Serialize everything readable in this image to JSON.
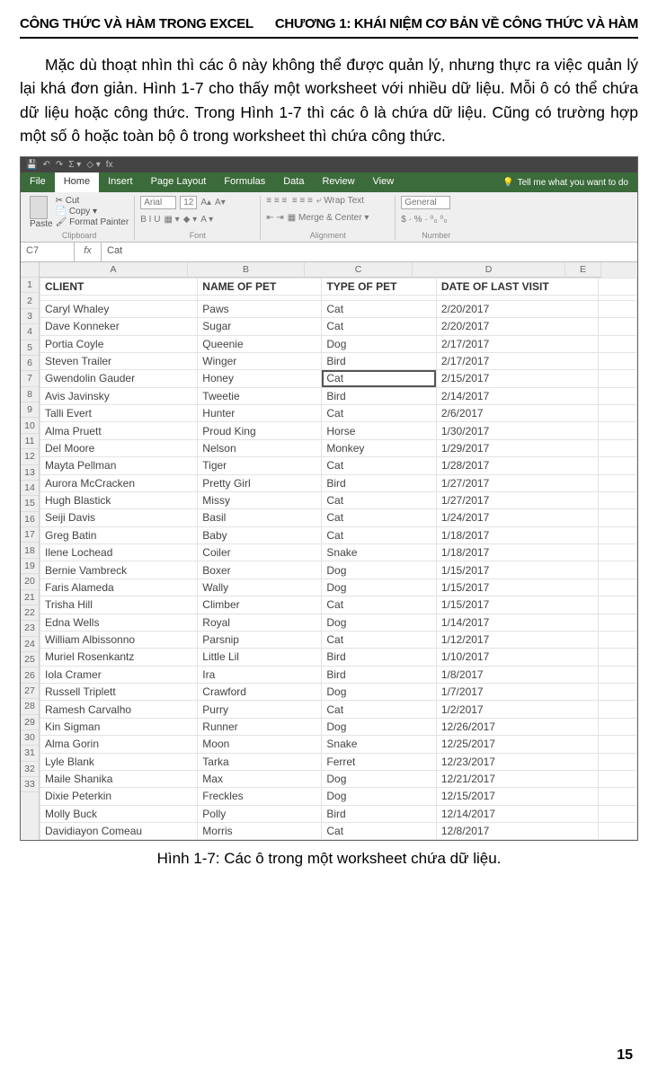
{
  "header": {
    "left": "CÔNG THỨC VÀ HÀM TRONG EXCEL",
    "right": "CHƯƠNG 1: KHÁI NIỆM CƠ BẢN VỀ CÔNG THỨC VÀ HÀM"
  },
  "paragraph": "Mặc dù thoạt nhìn thì các ô này không thể được quản lý, nhưng thực ra việc quản lý lại khá đơn giản. Hình 1-7 cho thấy một worksheet với nhiều dữ liệu. Mỗi ô có thể chứa dữ liệu hoặc công thức. Trong Hình 1-7 thì các ô là chứa dữ liệu. Cũng có trường hợp một số ô hoặc toàn bộ ô trong worksheet thì chứa công thức.",
  "excel": {
    "tabs": [
      "File",
      "Home",
      "Insert",
      "Page Layout",
      "Formulas",
      "Data",
      "Review",
      "View"
    ],
    "active_tab_index": 1,
    "tell_me": "Tell me what you want to do",
    "ribbon": {
      "clipboard": {
        "label": "Clipboard",
        "paste": "Paste",
        "cut": "Cut",
        "copy": "Copy",
        "painter": "Format Painter"
      },
      "font": {
        "label": "Font",
        "name": "Arial",
        "size": "12",
        "buttons": "B  I  U"
      },
      "alignment": {
        "label": "Alignment",
        "wrap": "Wrap Text",
        "merge": "Merge & Center"
      },
      "number": {
        "label": "Number",
        "format": "General",
        "symbols": "$ · % · ⁰₀ ⁰₀"
      }
    },
    "name_box": "C7",
    "fx_content": "Cat",
    "columns": [
      "A",
      "B",
      "C",
      "D",
      "E"
    ],
    "headers": [
      "CLIENT",
      "NAME OF PET",
      "TYPE OF PET",
      "DATE OF LAST VISIT",
      ""
    ],
    "selected": {
      "row": 7,
      "col": 2
    },
    "rows": [
      [
        "",
        "",
        "",
        "",
        ""
      ],
      [
        "Caryl Whaley",
        "Paws",
        "Cat",
        "2/20/2017",
        ""
      ],
      [
        "Dave Konneker",
        "Sugar",
        "Cat",
        "2/20/2017",
        ""
      ],
      [
        "Portia Coyle",
        "Queenie",
        "Dog",
        "2/17/2017",
        ""
      ],
      [
        "Steven Trailer",
        "Winger",
        "Bird",
        "2/17/2017",
        ""
      ],
      [
        "Gwendolin Gauder",
        "Honey",
        "Cat",
        "2/15/2017",
        ""
      ],
      [
        "Avis Javinsky",
        "Tweetie",
        "Bird",
        "2/14/2017",
        ""
      ],
      [
        "Talli Evert",
        "Hunter",
        "Cat",
        "2/6/2017",
        ""
      ],
      [
        "Alma Pruett",
        "Proud King",
        "Horse",
        "1/30/2017",
        ""
      ],
      [
        "Del Moore",
        "Nelson",
        "Monkey",
        "1/29/2017",
        ""
      ],
      [
        "Mayta Pellman",
        "Tiger",
        "Cat",
        "1/28/2017",
        ""
      ],
      [
        "Aurora McCracken",
        "Pretty Girl",
        "Bird",
        "1/27/2017",
        ""
      ],
      [
        "Hugh Blastick",
        "Missy",
        "Cat",
        "1/27/2017",
        ""
      ],
      [
        "Seiji Davis",
        "Basil",
        "Cat",
        "1/24/2017",
        ""
      ],
      [
        "Greg Batin",
        "Baby",
        "Cat",
        "1/18/2017",
        ""
      ],
      [
        "Ilene Lochead",
        "Coiler",
        "Snake",
        "1/18/2017",
        ""
      ],
      [
        "Bernie Vambreck",
        "Boxer",
        "Dog",
        "1/15/2017",
        ""
      ],
      [
        "Faris Alameda",
        "Wally",
        "Dog",
        "1/15/2017",
        ""
      ],
      [
        "Trisha Hill",
        "Climber",
        "Cat",
        "1/15/2017",
        ""
      ],
      [
        "Edna Wells",
        "Royal",
        "Dog",
        "1/14/2017",
        ""
      ],
      [
        "William Albissonno",
        "Parsnip",
        "Cat",
        "1/12/2017",
        ""
      ],
      [
        "Muriel Rosenkantz",
        "Little Lil",
        "Bird",
        "1/10/2017",
        ""
      ],
      [
        "Iola Cramer",
        "Ira",
        "Bird",
        "1/8/2017",
        ""
      ],
      [
        "Russell Triplett",
        "Crawford",
        "Dog",
        "1/7/2017",
        ""
      ],
      [
        "Ramesh Carvalho",
        "Purry",
        "Cat",
        "1/2/2017",
        ""
      ],
      [
        "Kin Sigman",
        "Runner",
        "Dog",
        "12/26/2017",
        ""
      ],
      [
        "Alma Gorin",
        "Moon",
        "Snake",
        "12/25/2017",
        ""
      ],
      [
        "Lyle Blank",
        "Tarka",
        "Ferret",
        "12/23/2017",
        ""
      ],
      [
        "Maile Shanika",
        "Max",
        "Dog",
        "12/21/2017",
        ""
      ],
      [
        "Dixie Peterkin",
        "Freckles",
        "Dog",
        "12/15/2017",
        ""
      ],
      [
        "Molly Buck",
        "Polly",
        "Bird",
        "12/14/2017",
        ""
      ],
      [
        "Davidiayon Comeau",
        "Morris",
        "Cat",
        "12/8/2017",
        ""
      ]
    ]
  },
  "caption": "Hình 1-7: Các ô trong một worksheet chứa dữ liệu.",
  "page_number": "15"
}
